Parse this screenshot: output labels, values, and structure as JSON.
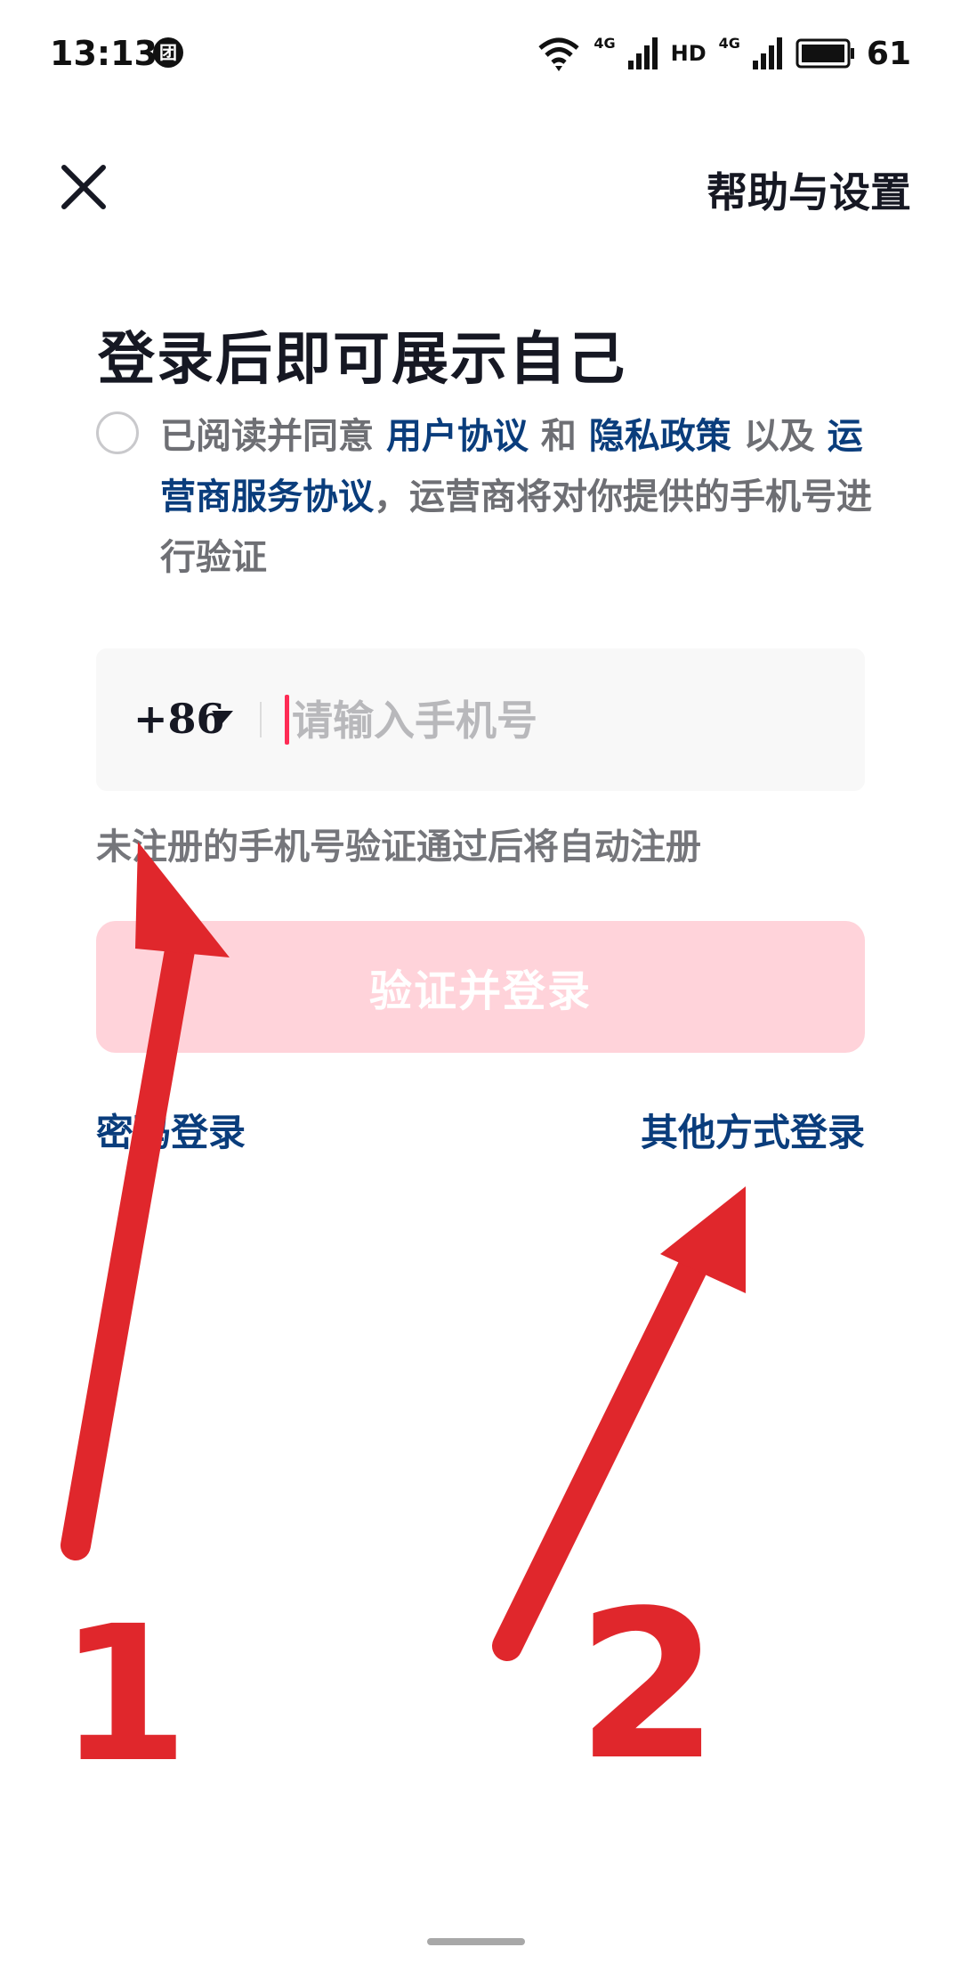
{
  "status_bar": {
    "time": "13:13",
    "app_icon_glyph": "团",
    "signal_1_label": "4G",
    "hd_label": "HD",
    "signal_2_label": "4G",
    "battery": "61"
  },
  "header": {
    "help_settings": "帮助与设置"
  },
  "title": "登录后即可展示自己",
  "agreement": {
    "part1": "已阅读并同意 ",
    "user_agreement": "用户协议",
    "and": " 和 ",
    "privacy_policy": "隐私政策",
    "also": " 以及 ",
    "carrier_agreement": "运营商服务协议",
    "part2": "，运营商将对你提供的手机号进行验证"
  },
  "phone": {
    "country_code": "+86",
    "placeholder": "请输入手机号",
    "value": ""
  },
  "hint": "未注册的手机号验证通过后将自动注册",
  "primary_button": "验证并登录",
  "links": {
    "password_login": "密码登录",
    "other_login": "其他方式登录"
  },
  "annotations": {
    "label_1": "1",
    "label_2": "2",
    "color": "#e0272c"
  },
  "colors": {
    "brand_pink": "#fe2c55",
    "button_disabled": "#ffd3da",
    "link_blue": "#0a3d7c",
    "text_dark": "#161823",
    "text_grey": "#6e6f74"
  }
}
